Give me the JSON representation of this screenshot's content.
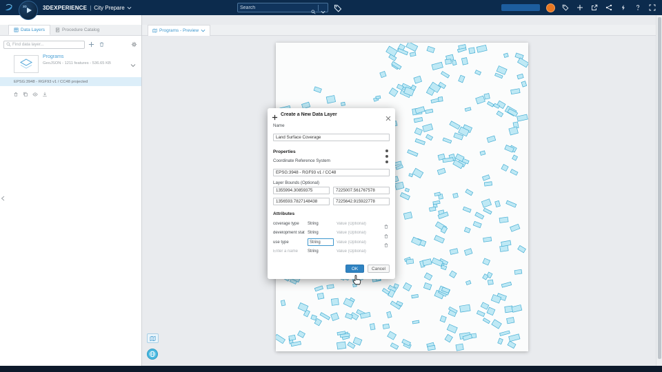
{
  "topbar": {
    "brand": "3DEXPERIENCE",
    "divider": "|",
    "app_name": "City Prepare",
    "search_placeholder": "Search",
    "compass_label": "3D",
    "right_icons": [
      "tag",
      "add",
      "share",
      "share-nodes",
      "lightning",
      "help",
      "fullscreen"
    ]
  },
  "sidebar": {
    "tabs": [
      {
        "label": "Data Layers"
      },
      {
        "label": "Procedure Catalog"
      }
    ],
    "search_placeholder": "Find data layer...",
    "layer": {
      "title": "Programs",
      "meta": "GeoJSON - 1211 features - 536.65 KB",
      "crs": "EPSG:3948 - RGF93 v1 / CC48 projected"
    }
  },
  "main": {
    "preview_tab": "Programs - Preview"
  },
  "dialog": {
    "title": "Create a New Data Layer",
    "name_label": "Name",
    "name_value": "Land Surface Coverage",
    "properties_label": "Properties",
    "crs_label": "Coordinate Reference System",
    "crs_value": "EPSG:3948 - RGF93 v1 / CC48",
    "bounds_label": "Layer Bounds (Optional)",
    "bounds": {
      "min_x": "1355994.30859375",
      "min_y": "7225007.561767578",
      "max_x": "1356593.7827148438",
      "max_y": "7225642.915922778"
    },
    "attributes_label": "Attributes",
    "attributes": [
      {
        "name": "coverage type",
        "type": "String",
        "value_placeholder": "Value (Optional)"
      },
      {
        "name": "development stat",
        "type": "String",
        "value_placeholder": "Value (Optional)"
      },
      {
        "name": "use type",
        "type": "String",
        "value_placeholder": "Value (Optional)"
      },
      {
        "name_placeholder": "Enter a name",
        "type": "String",
        "value_placeholder": "Value (Optional)"
      }
    ],
    "ok_label": "OK",
    "cancel_label": "Cancel"
  },
  "colors": {
    "topbar_bg": "#0c2b4d",
    "accent_blue": "#3c96cd",
    "building_fill": "#bfe9f5",
    "building_stroke": "#46aed4",
    "ok_bg": "#2f83c2",
    "avatar_orange": "#e87722"
  }
}
